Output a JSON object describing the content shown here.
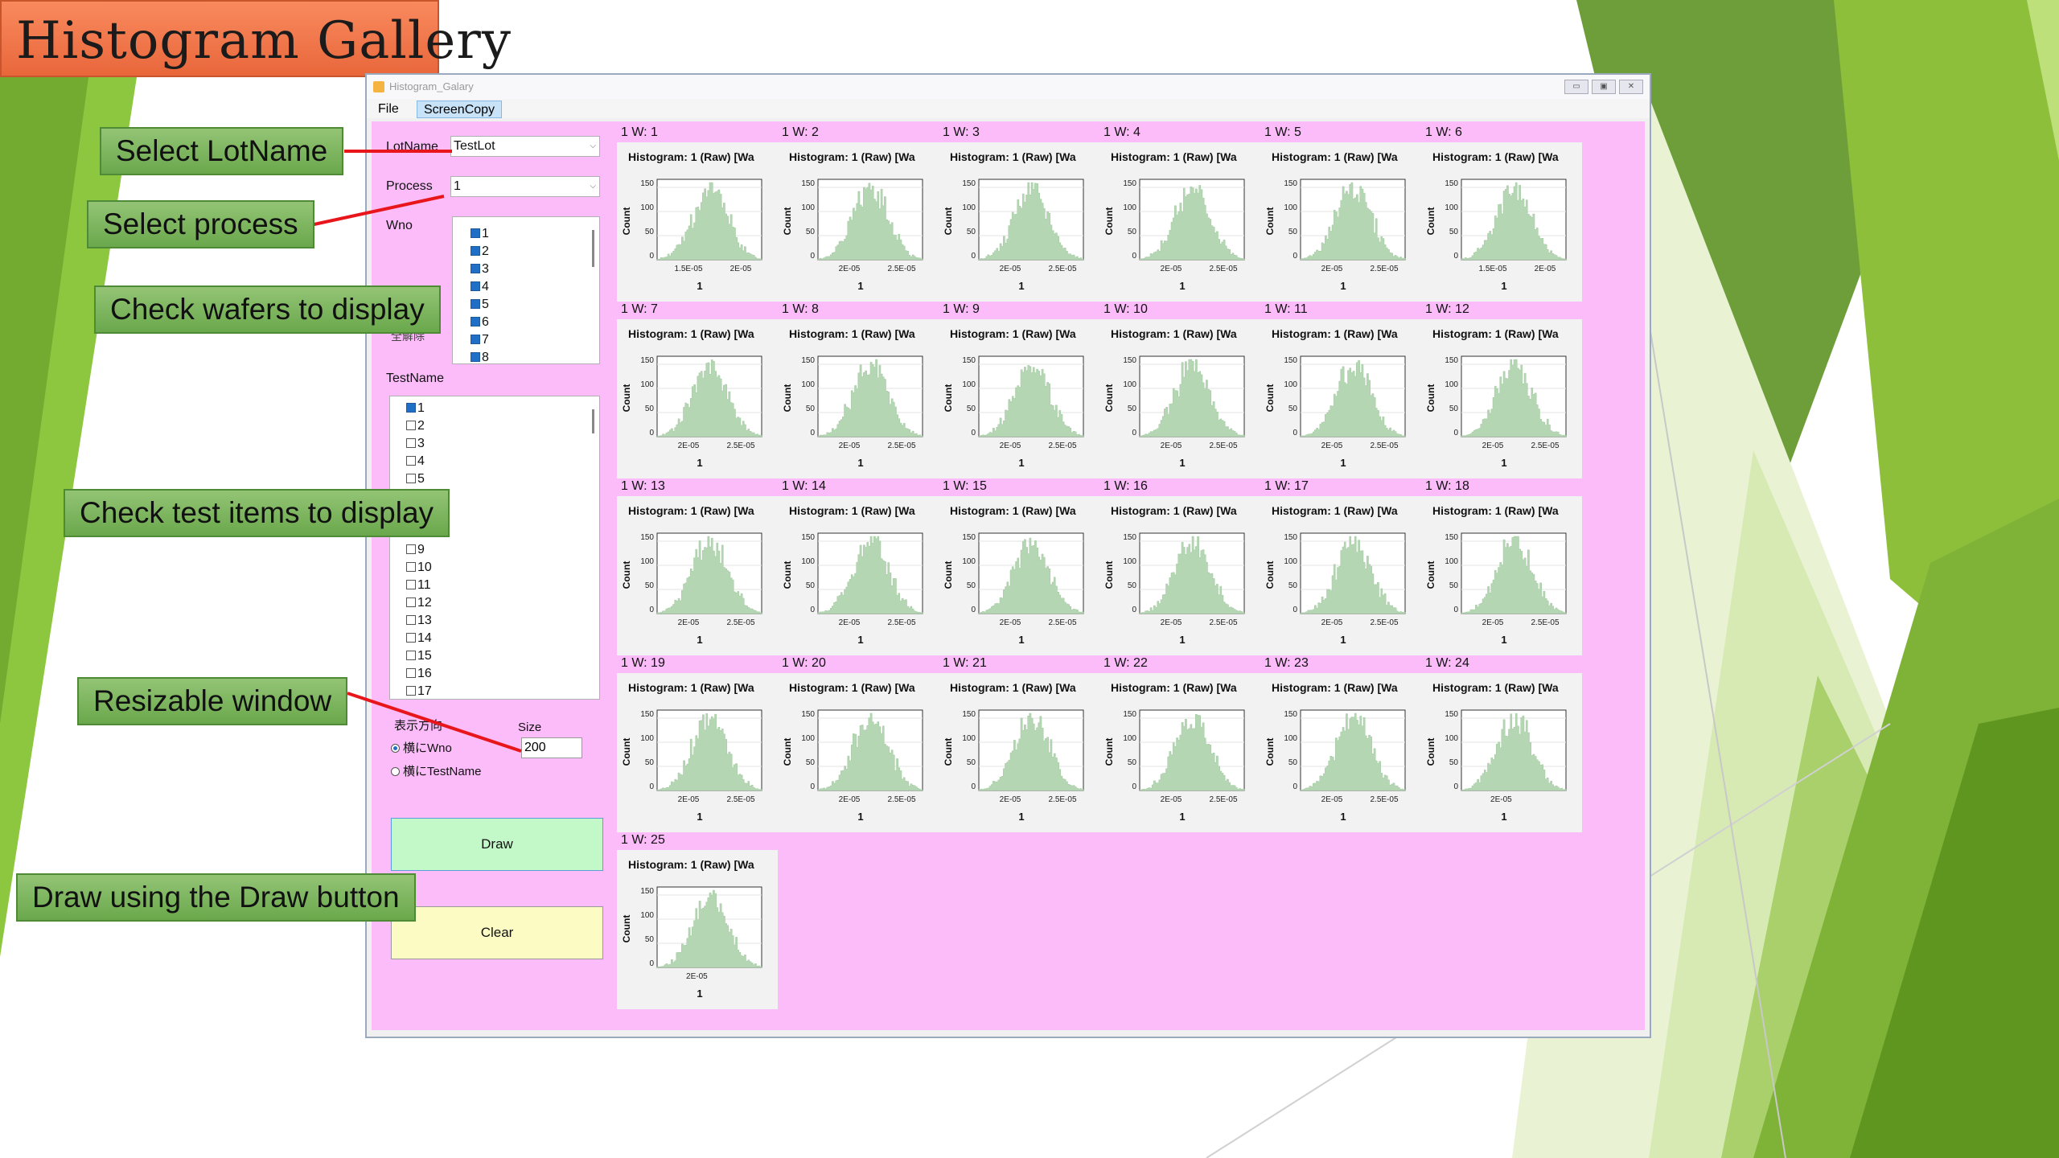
{
  "slide_title": "Histogram Gallery",
  "window": {
    "title": "Histogram_Galary",
    "buttons": [
      "▭",
      "▣",
      "✕"
    ],
    "menu": [
      "File",
      "ScreenCopy"
    ]
  },
  "form": {
    "lotname_label": "LotName",
    "lotname_value": "TestLot",
    "process_label": "Process",
    "process_value": "1",
    "wno_label": "Wno",
    "wno_items": [
      {
        "label": "1",
        "checked": true
      },
      {
        "label": "2",
        "checked": true
      },
      {
        "label": "3",
        "checked": true
      },
      {
        "label": "4",
        "checked": true
      },
      {
        "label": "5",
        "checked": true
      },
      {
        "label": "6",
        "checked": true
      },
      {
        "label": "7",
        "checked": true
      },
      {
        "label": "8",
        "checked": true
      }
    ],
    "clear_all_label": "全解除",
    "testname_label": "TestName",
    "testname_items": [
      {
        "label": "1",
        "checked": true
      },
      {
        "label": "2",
        "checked": false
      },
      {
        "label": "3",
        "checked": false
      },
      {
        "label": "4",
        "checked": false
      },
      {
        "label": "5",
        "checked": false
      },
      {
        "label": "9",
        "checked": false
      },
      {
        "label": "10",
        "checked": false
      },
      {
        "label": "11",
        "checked": false
      },
      {
        "label": "12",
        "checked": false
      },
      {
        "label": "13",
        "checked": false
      },
      {
        "label": "14",
        "checked": false
      },
      {
        "label": "15",
        "checked": false
      },
      {
        "label": "16",
        "checked": false
      },
      {
        "label": "17",
        "checked": false
      }
    ],
    "direction_label": "表示方向",
    "radio_wno": "横にWno",
    "radio_testname": "横にTestName",
    "size_label": "Size",
    "size_value": "200",
    "draw_label": "Draw",
    "clear_label": "Clear"
  },
  "callouts": {
    "select_lotname": "Select LotName",
    "select_process": "Select process",
    "check_wafers": "Check wafers to display",
    "check_tests": "Check test items to display",
    "resizable": "Resizable window",
    "draw_button": "Draw using the Draw button"
  },
  "histogram": {
    "panel_title": "Histogram: 1 (Raw)  [Wa",
    "ylabel": "Count",
    "xlabel": "1",
    "yticks": [
      "150",
      "100",
      "50",
      "0"
    ],
    "panels": [
      {
        "header": "1  W: 1",
        "xticks": [
          "1.5E-05",
          "2E-05"
        ]
      },
      {
        "header": "1  W: 2",
        "xticks": [
          "2E-05",
          "2.5E-05"
        ]
      },
      {
        "header": "1  W: 3",
        "xticks": [
          "2E-05",
          "2.5E-05"
        ]
      },
      {
        "header": "1  W: 4",
        "xticks": [
          "2E-05",
          "2.5E-05"
        ]
      },
      {
        "header": "1  W: 5",
        "xticks": [
          "2E-05",
          "2.5E-05"
        ]
      },
      {
        "header": "1  W: 6",
        "xticks": [
          "1.5E-05",
          "2E-05"
        ]
      },
      {
        "header": "1  W: 7",
        "xticks": [
          "2E-05",
          "2.5E-05"
        ]
      },
      {
        "header": "1  W: 8",
        "xticks": [
          "2E-05",
          "2.5E-05"
        ]
      },
      {
        "header": "1  W: 9",
        "xticks": [
          "2E-05",
          "2.5E-05"
        ]
      },
      {
        "header": "1  W: 10",
        "xticks": [
          "2E-05",
          "2.5E-05"
        ]
      },
      {
        "header": "1  W: 11",
        "xticks": [
          "2E-05",
          "2.5E-05"
        ]
      },
      {
        "header": "1  W: 12",
        "xticks": [
          "2E-05",
          "2.5E-05"
        ]
      },
      {
        "header": "1  W: 13",
        "xticks": [
          "2E-05",
          "2.5E-05"
        ]
      },
      {
        "header": "1  W: 14",
        "xticks": [
          "2E-05",
          "2.5E-05"
        ]
      },
      {
        "header": "1  W: 15",
        "xticks": [
          "2E-05",
          "2.5E-05"
        ]
      },
      {
        "header": "1  W: 16",
        "xticks": [
          "2E-05",
          "2.5E-05"
        ]
      },
      {
        "header": "1  W: 17",
        "xticks": [
          "2E-05",
          "2.5E-05"
        ]
      },
      {
        "header": "1  W: 18",
        "xticks": [
          "2E-05",
          "2.5E-05"
        ]
      },
      {
        "header": "1  W: 19",
        "xticks": [
          "2E-05",
          "2.5E-05"
        ]
      },
      {
        "header": "1  W: 20",
        "xticks": [
          "2E-05",
          "2.5E-05"
        ]
      },
      {
        "header": "1  W: 21",
        "xticks": [
          "2E-05",
          "2.5E-05"
        ]
      },
      {
        "header": "1  W: 22",
        "xticks": [
          "2E-05",
          "2.5E-05"
        ]
      },
      {
        "header": "1  W: 23",
        "xticks": [
          "2E-05",
          "2.5E-05"
        ]
      },
      {
        "header": "1  W: 24",
        "xticks": [
          "2E-05"
        ]
      },
      {
        "header": "1  W: 25",
        "xticks": [
          "2E-05"
        ]
      }
    ]
  },
  "colors": {
    "title_fill": "#f27a4c",
    "callout_fill": "#7fb862",
    "client_bg": "#fbbcf9",
    "panel_bg": "#f2f2f2",
    "bar_fill": "#b5d6b3",
    "draw_fill": "#c3f9c8",
    "clear_fill": "#fbfbc3",
    "leader_line": "#e8151b"
  }
}
